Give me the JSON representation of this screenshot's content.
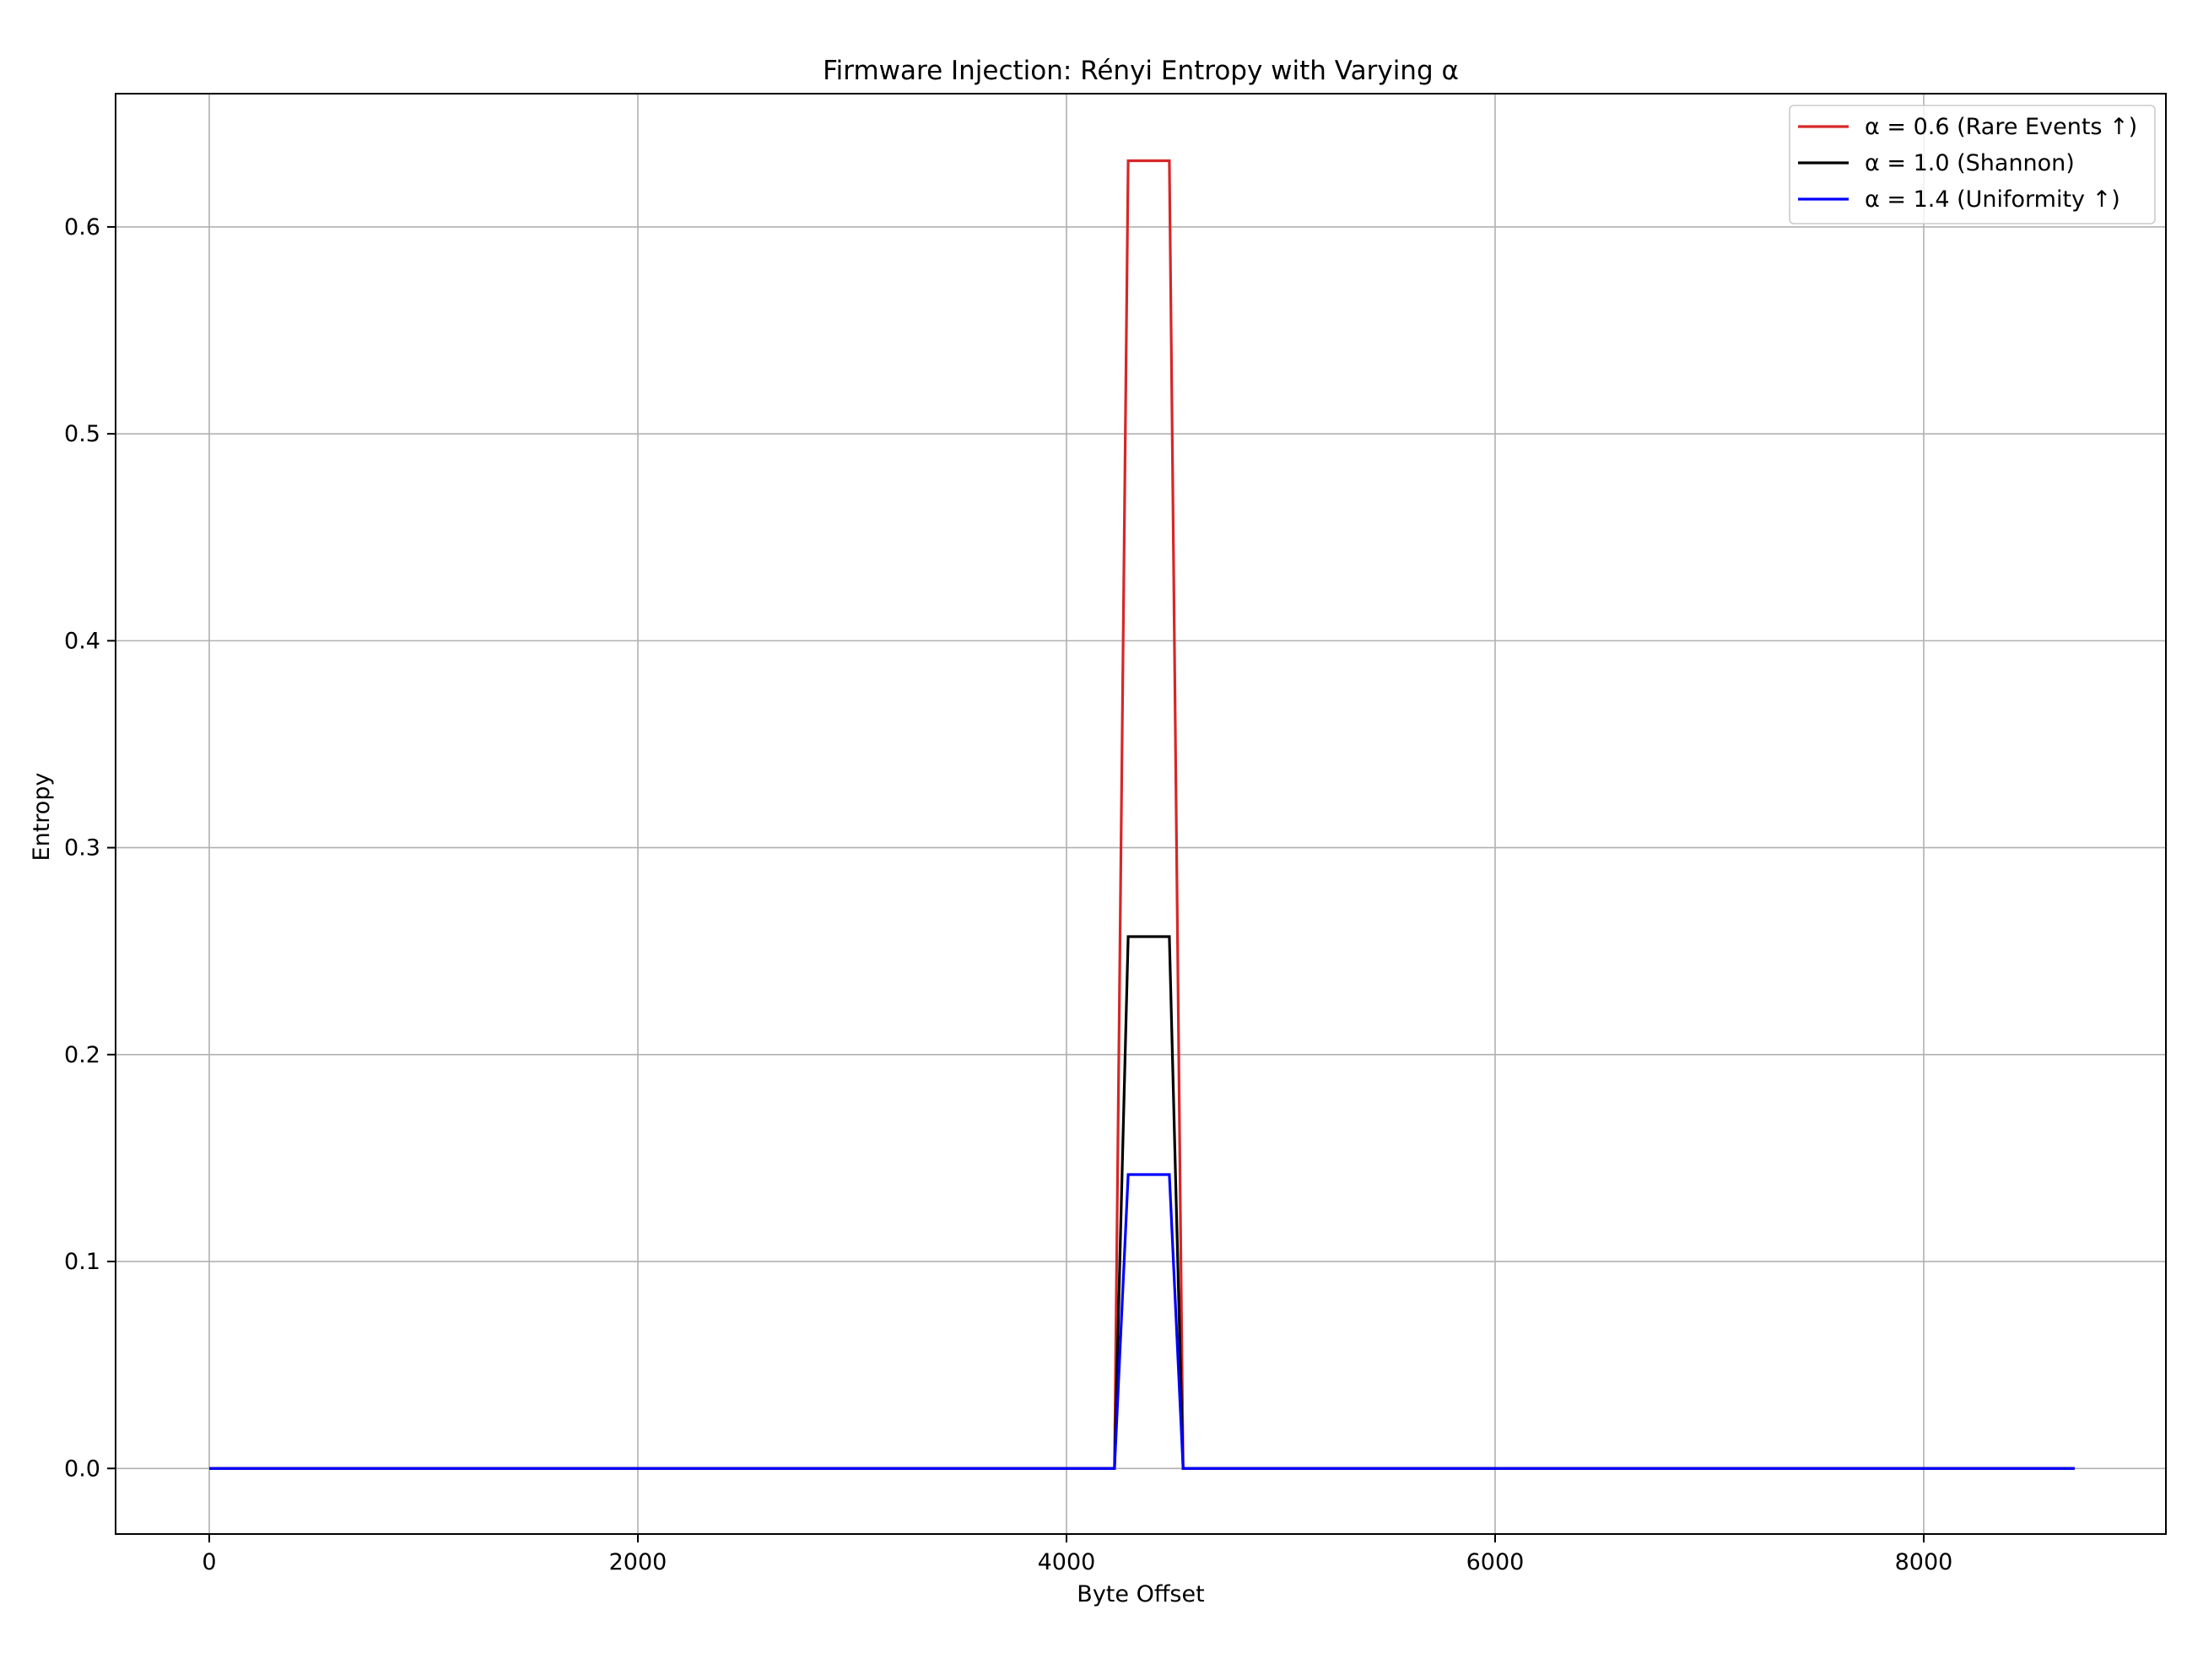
{
  "chart_data": {
    "type": "line",
    "title": "Firmware Injection: Rényi Entropy with Varying α",
    "xlabel": "Byte Offset",
    "ylabel": "Entropy",
    "xlim": [
      -437,
      9130
    ],
    "ylim": [
      -0.0317,
      0.6644
    ],
    "x_ticks": [
      0,
      2000,
      4000,
      6000,
      8000
    ],
    "x_tick_labels": [
      "0",
      "2000",
      "4000",
      "6000",
      "8000"
    ],
    "y_ticks": [
      0.0,
      0.1,
      0.2,
      0.3,
      0.4,
      0.5,
      0.6
    ],
    "y_tick_labels": [
      "0.0",
      "0.1",
      "0.2",
      "0.3",
      "0.4",
      "0.5",
      "0.6"
    ],
    "grid": true,
    "legend_position": "top-right",
    "series": [
      {
        "name": "α = 0.6 (Rare Events ↑)",
        "color": "#d62728",
        "x": [
          0,
          4224,
          4288,
          4480,
          4544,
          8704
        ],
        "y": [
          0.0,
          0.0,
          0.632,
          0.632,
          0.0,
          0.0
        ]
      },
      {
        "name": "α = 1.0 (Shannon)",
        "color": "#000000",
        "x": [
          0,
          4224,
          4288,
          4480,
          4544,
          8704
        ],
        "y": [
          0.0,
          0.0,
          0.257,
          0.257,
          0.0,
          0.0
        ]
      },
      {
        "name": "α = 1.4 (Uniformity ↑)",
        "color": "#0000ff",
        "x": [
          0,
          4224,
          4288,
          4480,
          4544,
          8704
        ],
        "y": [
          0.0,
          0.0,
          0.142,
          0.142,
          0.0,
          0.0
        ]
      }
    ]
  }
}
